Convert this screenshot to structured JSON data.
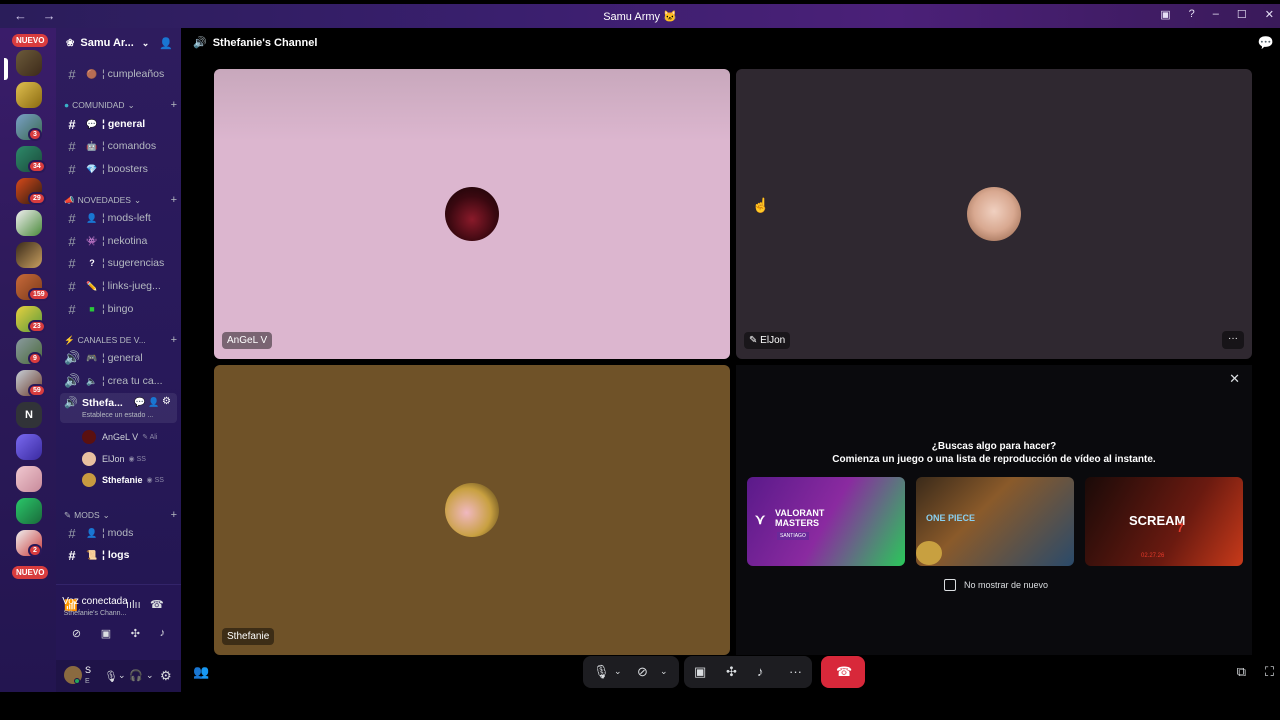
{
  "window": {
    "title": "Samu Army 🐱",
    "nav_label": "← →",
    "controls": [
      "▣",
      "?",
      "–",
      "☐",
      "✕"
    ]
  },
  "servers": {
    "nuevo_top": "NUEVO",
    "nuevo_bottom": "NUEVO",
    "letter_server": "N",
    "badges": [
      "3",
      "34",
      "29",
      "159",
      "23",
      "9",
      "59",
      "2"
    ]
  },
  "guild": {
    "name": "Samu Ar...",
    "categories": {
      "comunidad": "COMUNIDAD",
      "novedades": "NOVEDADES",
      "canales_voz": "CANALES DE V...",
      "mods": "MODS"
    },
    "channels": {
      "cumpleanos": "¦ cumpleaños",
      "general": "¦ general",
      "comandos": "¦ comandos",
      "boosters": "¦ boosters",
      "mods_left": "¦ mods-left",
      "nekotina": "¦ nekotina",
      "sugerencias": "¦ sugerencias",
      "links": "¦ links-jueg...",
      "bingo": "¦ bingo",
      "v_general": "¦ general",
      "v_crea": "¦ crea tu ca...",
      "sthefa": "Sthefa...",
      "sthefa_status": "Establece un estado ...",
      "mods": "¦ mods",
      "logs": "¦ logs"
    },
    "voice_users": [
      {
        "name": "AnGeL V",
        "extra": "✎ Ali"
      },
      {
        "name": "ElJon",
        "extra": "◉ SS"
      },
      {
        "name": "Sthefanie",
        "extra": "◉ SS"
      }
    ]
  },
  "voice": {
    "status": "Voz conectada",
    "channel": "Sthefanie's Chann..."
  },
  "user": {
    "initial": "S",
    "sub": "E"
  },
  "header": {
    "channel": "Sthefanie's Channel"
  },
  "tiles": {
    "angel": "AnGeL V",
    "eljon": "ElJon",
    "sthefanie": "Sthefanie"
  },
  "activity": {
    "line1": "¿Buscas algo para hacer?",
    "line2": "Comienza un juego o una lista de reproducción de vídeo al instante.",
    "card1_title": "VALORANT MASTERS",
    "card1_sub": "SANTIAGO",
    "card2_title": "ONE PIECE",
    "card3_title": "SCREAM",
    "card3_num": "7",
    "card3_date": "02.27.26",
    "dont_show": "No mostrar de nuevo"
  },
  "colors": {
    "tile_pink": "#dcb6cf",
    "tile_dark": "#2f2830",
    "tile_brown": "#6f5228",
    "hangup": "#d8283a"
  }
}
